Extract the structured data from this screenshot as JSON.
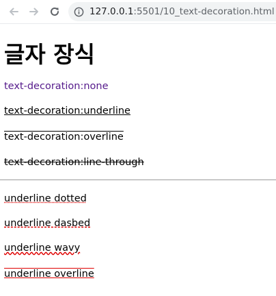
{
  "browser": {
    "back_icon": "arrow-left-icon",
    "forward_icon": "arrow-right-icon",
    "reload_icon": "reload-icon",
    "info_icon": "info-icon",
    "url_host": "127.0.0.1",
    "url_path": ":5501/10_text-decoration.html"
  },
  "page": {
    "title": "글자 장식",
    "items": [
      "text-decoration:none",
      "text-decoration:underline",
      "text-decoration:overline",
      "text-decoration:line-through",
      "underline dotted",
      "underline dasbed",
      "underline wavy",
      "underline overline"
    ]
  },
  "colors": {
    "link_visited": "#551a8b",
    "decoration_red": "#e00000"
  }
}
